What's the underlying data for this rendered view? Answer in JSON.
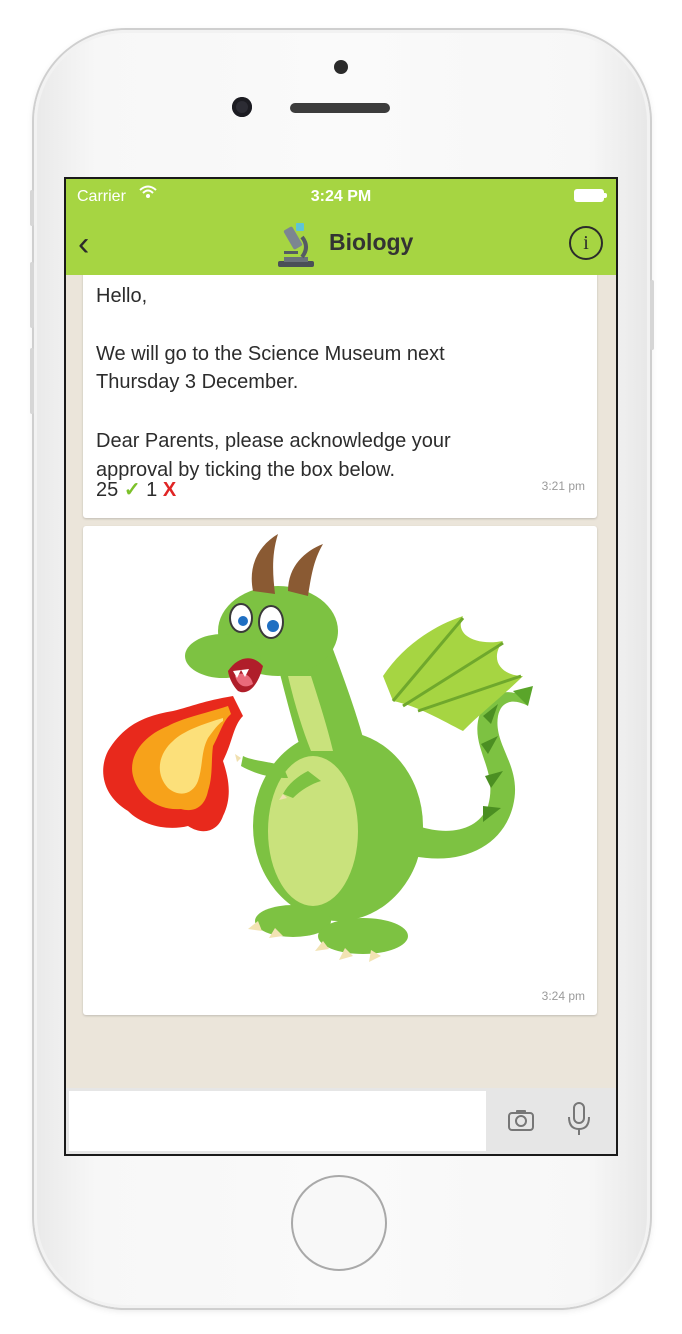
{
  "status_bar": {
    "carrier": "Carrier",
    "time": "3:24 PM"
  },
  "nav": {
    "title": "Biology",
    "info_label": "i",
    "back_glyph": "‹"
  },
  "messages": [
    {
      "paragraphs": [
        "Hello,",
        "We will go to the Science Museum next",
        "Thursday 3 December.",
        "Dear Parents, please acknowledge your",
        "approval by ticking the box below."
      ],
      "approve_count": "25",
      "check_glyph": "✓",
      "reject_count": "1",
      "cross_glyph": "X",
      "time": "3:21 pm"
    },
    {
      "image": "dragon-illustration",
      "time": "3:24 pm"
    }
  ],
  "input": {
    "placeholder": ""
  },
  "icons": [
    "wifi-icon",
    "battery-icon",
    "back-chevron-icon",
    "microscope-icon",
    "info-icon",
    "camera-icon",
    "microphone-icon"
  ],
  "colors": {
    "header_green": "#a6d542",
    "chat_background": "#ebe5da",
    "check_green": "#7cc12a",
    "cross_red": "#e02525"
  }
}
